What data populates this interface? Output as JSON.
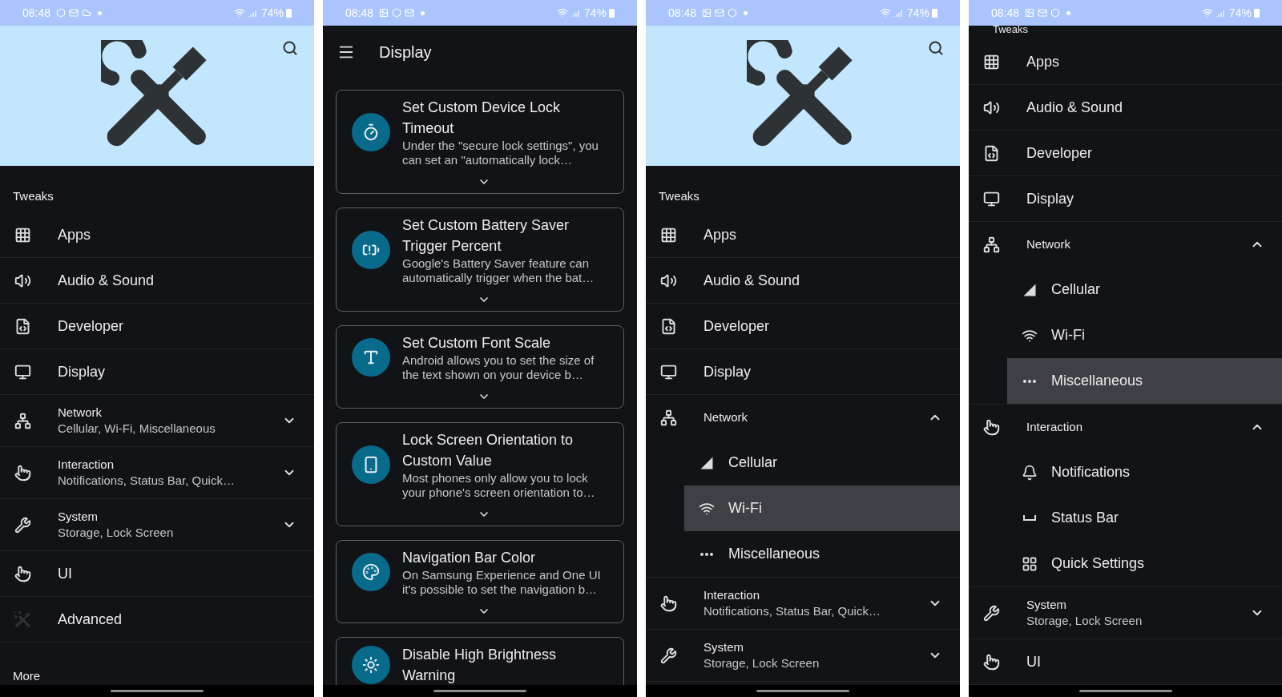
{
  "screens": [
    {
      "kind": "drawer",
      "status": {
        "time": "08:48",
        "battery": "74%"
      },
      "hero": true,
      "section": "Tweaks",
      "items": [
        {
          "label": "Apps",
          "kind": "grid"
        },
        {
          "label": "Audio & Sound",
          "kind": "volume"
        },
        {
          "label": "Developer",
          "kind": "code"
        },
        {
          "label": "Display",
          "kind": "monitor"
        },
        {
          "label": "Network",
          "kind": "network",
          "subtitle": "Cellular, Wi-Fi, Miscellaneous",
          "expanded": false
        },
        {
          "label": "Interaction",
          "kind": "hand",
          "subtitle": "Notifications, Status Bar, Quick…",
          "expanded": false
        },
        {
          "label": "System",
          "kind": "wrench",
          "subtitle": "Storage, Lock Screen",
          "expanded": false
        },
        {
          "label": "UI",
          "kind": "hand"
        },
        {
          "label": "Advanced",
          "kind": "tools"
        }
      ],
      "footer": "More"
    },
    {
      "kind": "list",
      "status": {
        "time": "08:48",
        "battery": "74%"
      },
      "title": "Display",
      "cards": [
        {
          "title": "Set Custom Device Lock Timeout",
          "description": "Under the \"secure lock settings\", you can set an \"automatically lock…",
          "kind": "timer"
        },
        {
          "title": "Set Custom Battery Saver Trigger Percent",
          "description": "Google's Battery Saver feature can automatically trigger when the bat…",
          "kind": "battery"
        },
        {
          "title": "Set Custom Font Scale",
          "description": "Android allows you to set the size of the text shown on your device b…",
          "kind": "type"
        },
        {
          "title": "Lock Screen Orientation to Custom Value",
          "description": "Most phones only allow you to lock your phone's screen orientation to…",
          "kind": "rotate"
        },
        {
          "title": "Navigation Bar Color",
          "description": "On Samsung Experience and One UI it's possible to set the navigation b…",
          "kind": "palette"
        },
        {
          "title": "Disable High Brightness Warning",
          "kind": "sun"
        }
      ]
    },
    {
      "kind": "drawer",
      "status": {
        "time": "08:48",
        "battery": "74%"
      },
      "hero": true,
      "section": "Tweaks",
      "items": [
        {
          "label": "Apps",
          "kind": "grid"
        },
        {
          "label": "Audio & Sound",
          "kind": "volume"
        },
        {
          "label": "Developer",
          "kind": "code"
        },
        {
          "label": "Display",
          "kind": "monitor"
        },
        {
          "label": "Network",
          "kind": "network",
          "expanded": true,
          "children": [
            {
              "label": "Cellular",
              "kind": "signal",
              "selected": false
            },
            {
              "label": "Wi-Fi",
              "kind": "wifi",
              "selected": true
            },
            {
              "label": "Miscellaneous",
              "kind": "dots",
              "selected": false
            }
          ]
        },
        {
          "label": "Interaction",
          "kind": "hand",
          "subtitle": "Notifications, Status Bar, Quick…",
          "expanded": false
        },
        {
          "label": "System",
          "kind": "wrench",
          "subtitle": "Storage, Lock Screen",
          "expanded": false
        }
      ]
    },
    {
      "kind": "drawer",
      "status": {
        "time": "08:48",
        "battery": "74%"
      },
      "hero": false,
      "section": "Tweaks",
      "items": [
        {
          "label": "Apps",
          "kind": "grid"
        },
        {
          "label": "Audio & Sound",
          "kind": "volume"
        },
        {
          "label": "Developer",
          "kind": "code"
        },
        {
          "label": "Display",
          "kind": "monitor"
        },
        {
          "label": "Network",
          "kind": "network",
          "expanded": true,
          "children": [
            {
              "label": "Cellular",
              "kind": "signal",
              "selected": false
            },
            {
              "label": "Wi-Fi",
              "kind": "wifi",
              "selected": false
            },
            {
              "label": "Miscellaneous",
              "kind": "dots",
              "selected": true
            }
          ]
        },
        {
          "label": "Interaction",
          "kind": "hand",
          "expanded": true,
          "children": [
            {
              "label": "Notifications",
              "kind": "bell",
              "selected": false
            },
            {
              "label": "Status Bar",
              "kind": "space",
              "selected": false
            },
            {
              "label": "Quick Settings",
              "kind": "tiles",
              "selected": false
            }
          ]
        },
        {
          "label": "System",
          "kind": "wrench",
          "subtitle": "Storage, Lock Screen",
          "expanded": false
        },
        {
          "label": "UI",
          "kind": "hand"
        }
      ]
    }
  ]
}
